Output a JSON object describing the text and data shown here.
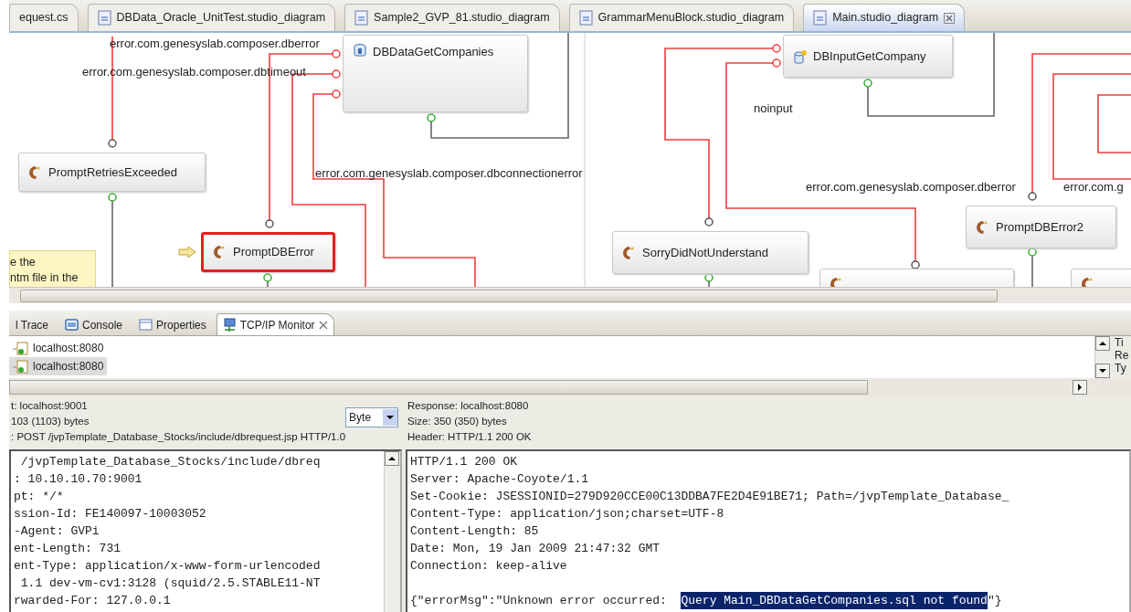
{
  "editor_tabs": [
    {
      "label": "equest.cs",
      "selected": false
    },
    {
      "label": "DBData_Oracle_UnitTest.studio_diagram",
      "selected": false
    },
    {
      "label": "Sample2_GVP_81.studio_diagram",
      "selected": false
    },
    {
      "label": "GrammarMenuBlock.studio_diagram",
      "selected": false
    },
    {
      "label": "Main.studio_diagram",
      "selected": true
    }
  ],
  "diagram": {
    "nodes": [
      {
        "label": "DBDataGetCompanies",
        "kind": "database",
        "selected": false
      },
      {
        "label": "PromptRetriesExceeded",
        "kind": "prompt",
        "selected": false
      },
      {
        "label": "PromptDBError",
        "kind": "prompt",
        "selected": true
      },
      {
        "label": "DBInputGetCompany",
        "kind": "input",
        "selected": false
      },
      {
        "label": "SorryDidNotUnderstand",
        "kind": "prompt",
        "selected": false
      },
      {
        "label": "PromptDBError2",
        "kind": "prompt",
        "selected": false
      },
      {
        "kind": "prompt",
        "selected": false
      },
      {
        "kind": "prompt",
        "selected": false
      }
    ],
    "edge_labels": [
      "error.com.genesyslab.composer.dberror",
      "error.com.genesyslab.composer.dbtimeout",
      "error.com.genesyslab.composer.dbconnectionerror",
      "noinput",
      "error.com.genesyslab.composer.dberror",
      "error.com.g"
    ],
    "note": {
      "lines": [
        "e the",
        "ntm file in the"
      ]
    }
  },
  "view_tabs": [
    {
      "label": "l Trace",
      "kind": "trace",
      "selected": false
    },
    {
      "label": "Console",
      "kind": "console",
      "selected": false
    },
    {
      "label": "Properties",
      "kind": "properties",
      "selected": false
    },
    {
      "label": "TCP/IP Monitor",
      "kind": "monitor",
      "selected": true
    }
  ],
  "monitor": {
    "entries": [
      {
        "label": "localhost:8080",
        "selected": false
      },
      {
        "label": "localhost:8080",
        "selected": true
      }
    ],
    "side_labels": [
      "Ti",
      "Re",
      "Ty"
    ]
  },
  "request": {
    "header": [
      "t: localhost:9001",
      "103 (1103) bytes",
      ": POST /jvpTemplate_Database_Stocks/include/dbrequest.jsp HTTP/1.0"
    ],
    "encoding": "Byte",
    "body": [
      " /jvpTemplate_Database_Stocks/include/dbreq",
      ": 10.10.10.70:9001",
      "pt: */*",
      "ssion-Id: FE140097-10003052",
      "-Agent: GVPi",
      "ent-Length: 731",
      "ent-Type: application/x-www-form-urlencoded",
      " 1.1 dev-vm-cv1:3128 (squid/2.5.STABLE11-NT",
      "rwarded-For: 127.0.0.1"
    ]
  },
  "response": {
    "header": [
      "Response: localhost:8080",
      "Size: 350 (350) bytes",
      "Header: HTTP/1.1 200 OK"
    ],
    "body": [
      "HTTP/1.1 200 OK",
      "Server: Apache-Coyote/1.1",
      "Set-Cookie: JSESSIONID=279D920CCE00C13DDBA7FE2D4E91BE71; Path=/jvpTemplate_Database_",
      "Content-Type: application/json;charset=UTF-8",
      "Content-Length: 85",
      "Date: Mon, 19 Jan 2009 21:47:32 GMT",
      "Connection: keep-alive"
    ],
    "last_line": [
      {
        "text": "{\"errorMsg\":\"Unknown error occurred:  ",
        "selected": false
      },
      {
        "text": "Query Main_DBDataGetCompanies.sql not found",
        "selected": true
      },
      {
        "text": "\"}",
        "selected": false
      }
    ]
  }
}
